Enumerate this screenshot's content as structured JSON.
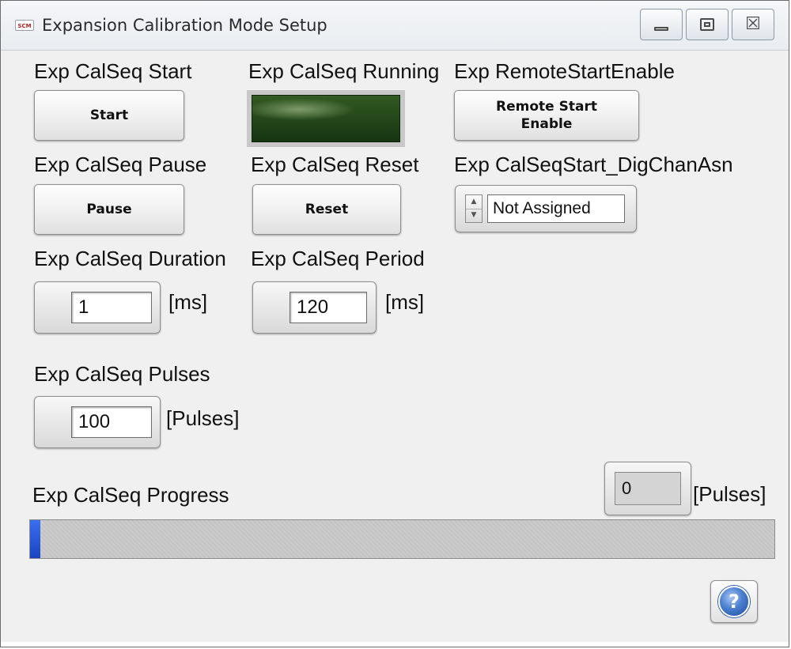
{
  "window": {
    "app_icon_text": "SCM",
    "title": "Expansion Calibration Mode Setup",
    "controls": {
      "minimize": "minimize-icon",
      "maximize": "maximize-icon",
      "close": "close-icon",
      "close_glyph": "☒"
    }
  },
  "start": {
    "label": "Exp CalSeq Start",
    "button": "Start"
  },
  "running": {
    "label": "Exp CalSeq Running",
    "led_state": "off",
    "led_color": "#1f4716"
  },
  "remote_start": {
    "label": "Exp RemoteStartEnable",
    "button_line1": "Remote Start",
    "button_line2": "Enable"
  },
  "pause": {
    "label": "Exp CalSeq Pause",
    "button": "Pause"
  },
  "reset": {
    "label": "Exp CalSeq Reset",
    "button": "Reset"
  },
  "dig_chan": {
    "label": "Exp CalSeqStart_DigChanAsn",
    "value": "Not Assigned"
  },
  "duration": {
    "label": "Exp CalSeq Duration",
    "value": "1",
    "unit": "[ms]"
  },
  "period": {
    "label": "Exp CalSeq Period",
    "value": "120",
    "unit": "[ms]"
  },
  "pulses": {
    "label": "Exp CalSeq Pulses",
    "value": "100",
    "unit": "[Pulses]"
  },
  "progress": {
    "label": "Exp CalSeq Progress",
    "count": "0",
    "unit": "[Pulses]",
    "fraction": 0.0,
    "fill_color": "#1b44c2"
  },
  "help": {
    "icon": "help-icon",
    "glyph": "?"
  }
}
